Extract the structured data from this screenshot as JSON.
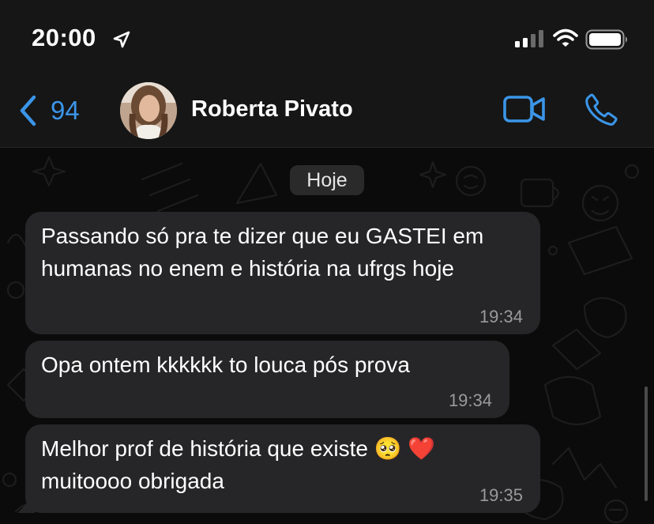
{
  "status_bar": {
    "time": "20:00"
  },
  "nav": {
    "back_count": "94",
    "contact_name": "Roberta Pivato"
  },
  "chat": {
    "date_chip": "Hoje",
    "messages": [
      {
        "text": "Passando só pra te dizer que eu GASTEI em humanas no enem e história na ufrgs hoje",
        "time": "19:34"
      },
      {
        "text": "Opa ontem kkkkkk to louca pós prova",
        "time": "19:34"
      },
      {
        "text": "Melhor prof de história que existe 🥺 ❤️ muitoooo obrigada",
        "time": "19:35"
      }
    ]
  },
  "colors": {
    "accent_blue": "#3b95e8",
    "incoming_bubble": "#262628",
    "background": "#0b0b0b"
  },
  "icons": [
    "location-arrow-icon",
    "signal-icon",
    "wifi-icon",
    "battery-icon",
    "chevron-left-icon",
    "video-call-icon",
    "phone-icon"
  ]
}
